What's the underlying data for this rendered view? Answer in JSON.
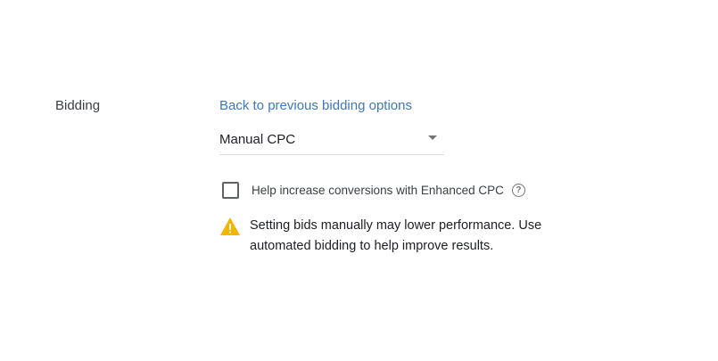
{
  "section": {
    "label": "Bidding"
  },
  "back_link": {
    "label": "Back to previous bidding options"
  },
  "bid_strategy": {
    "selected": "Manual CPC"
  },
  "enhanced_cpc": {
    "label": "Help increase conversions with Enhanced CPC",
    "checked": false,
    "help_icon_glyph": "?"
  },
  "warning": {
    "text": "Setting bids manually may lower performance. Use automated bidding to help improve results.",
    "icon": "warning-icon",
    "color": "#f4b400"
  },
  "colors": {
    "link": "#3b78c8",
    "divider": "#dadce0"
  }
}
